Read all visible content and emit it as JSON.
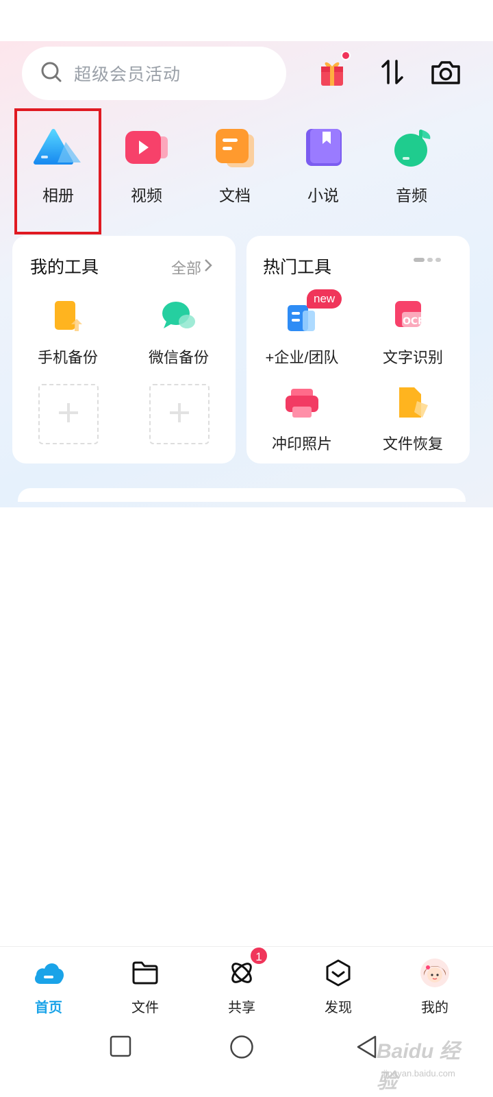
{
  "search": {
    "placeholder": "超级会员活动"
  },
  "top_icons": [
    "gift-icon",
    "transfer-icon",
    "camera-icon"
  ],
  "categories": [
    {
      "label": "相册",
      "icon": "album-icon"
    },
    {
      "label": "视频",
      "icon": "video-icon"
    },
    {
      "label": "文档",
      "icon": "document-icon"
    },
    {
      "label": "小说",
      "icon": "novel-icon"
    },
    {
      "label": "音频",
      "icon": "audio-icon"
    }
  ],
  "my_tools": {
    "title": "我的工具",
    "more_label": "全部",
    "items": [
      {
        "label": "手机备份",
        "icon": "phone-backup-icon"
      },
      {
        "label": "微信备份",
        "icon": "wechat-backup-icon"
      }
    ]
  },
  "hot_tools": {
    "title": "热门工具",
    "new_badge": "new",
    "items": [
      {
        "label": "+企业/团队",
        "icon": "enterprise-team-icon"
      },
      {
        "label": "文字识别",
        "icon": "ocr-icon",
        "icon_text": "OCR"
      },
      {
        "label": "冲印照片",
        "icon": "photo-print-icon"
      },
      {
        "label": "文件恢复",
        "icon": "file-recovery-icon"
      }
    ]
  },
  "tabs": [
    {
      "label": "首页",
      "icon": "cloud-home-icon",
      "active": true
    },
    {
      "label": "文件",
      "icon": "folder-icon"
    },
    {
      "label": "共享",
      "icon": "share-icon",
      "badge": "1"
    },
    {
      "label": "发现",
      "icon": "discover-icon"
    },
    {
      "label": "我的",
      "icon": "avatar-icon"
    }
  ],
  "watermark": {
    "text": "Baidu 经验",
    "url": "jingyan.baidu.com"
  },
  "colors": {
    "accent": "#1aa3e8",
    "badge": "#f0355a",
    "highlight": "#e01a22"
  }
}
